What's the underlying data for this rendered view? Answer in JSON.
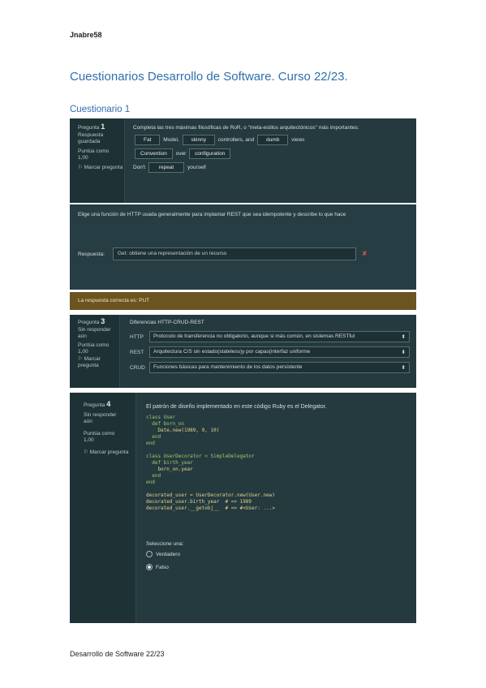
{
  "page": {
    "header": "Jnabre58",
    "title": "Cuestionarios Desarrollo de Software. Curso 22/23.",
    "section": "Cuestionario 1",
    "footer": "Desarrollo de Software 22/23"
  },
  "q1": {
    "num_label": "Pregunta",
    "num": "1",
    "status": [
      "Respuesta",
      "guardada"
    ],
    "score": [
      "Puntúa como",
      "1,00"
    ],
    "flag": "Marcar pregunta",
    "prompt": "Completa las tres máximas filosóficas de RoR, o \"meta-estilos arquitectónicos\" más importantes:",
    "line1": {
      "a": "Fat",
      "b": "Model,",
      "c": "skinny",
      "d": "controllers, and",
      "e": "dumb",
      "f": "views"
    },
    "line2": {
      "a": "Convention",
      "b": "over",
      "c": "configuration"
    },
    "line3": {
      "a": "Don't",
      "b": "repeat",
      "c": "yourself"
    }
  },
  "q2": {
    "prompt": "Elige una función de HTTP usada generalmente para implantar REST que sea idempotente y describe lo que hace",
    "answer_label": "Respuesta:",
    "answer_value": "Get: obtiene una representación de un recurso",
    "wrong_mark": "✘",
    "correct_note": "La respuesta correcta es: PUT"
  },
  "q3": {
    "num_label": "Pregunta",
    "num": "3",
    "status": [
      "Sin responder",
      "aún"
    ],
    "score": [
      "Puntúa como",
      "1,00"
    ],
    "flag": "Marcar pregunta",
    "prompt": "Diferencias HTTP-CRUD-REST",
    "rows": [
      {
        "label": "HTTP",
        "value": "Protocolo de transferencia no obligatorio, aunque si más común, en sistemas RESTful"
      },
      {
        "label": "REST",
        "value": "Arquitectura C/S sin estado(stateless)y por capas(interfaz uniforme"
      },
      {
        "label": "CRUD",
        "value": "Funciones básicas para mantenimiento de los datos persistente"
      }
    ]
  },
  "q4": {
    "num_label": "Pregunta",
    "num": "4",
    "status": [
      "Sin responder",
      "aún"
    ],
    "score": [
      "Puntúa como",
      "1,00"
    ],
    "flag": "Marcar pregunta",
    "prompt": "El patrón de diseño implementado en este código Ruby es el Delegator.",
    "code": [
      "class User",
      "  def born_on",
      "    Date.new(1989, 9, 10)",
      "  end",
      "end",
      "",
      "class UserDecorator < SimpleDelegator",
      "  def birth_year",
      "    born_on.year",
      "  end",
      "end",
      "",
      "decorated_user = UserDecorator.new(User.new)",
      "decorated_user.birth_year  # => 1989",
      "decorated_user.__getobj__  # => #<User: ...>"
    ],
    "select_label": "Seleccione una:",
    "options": [
      {
        "label": "Verdadero",
        "selected": false
      },
      {
        "label": "Falso",
        "selected": true
      }
    ]
  }
}
